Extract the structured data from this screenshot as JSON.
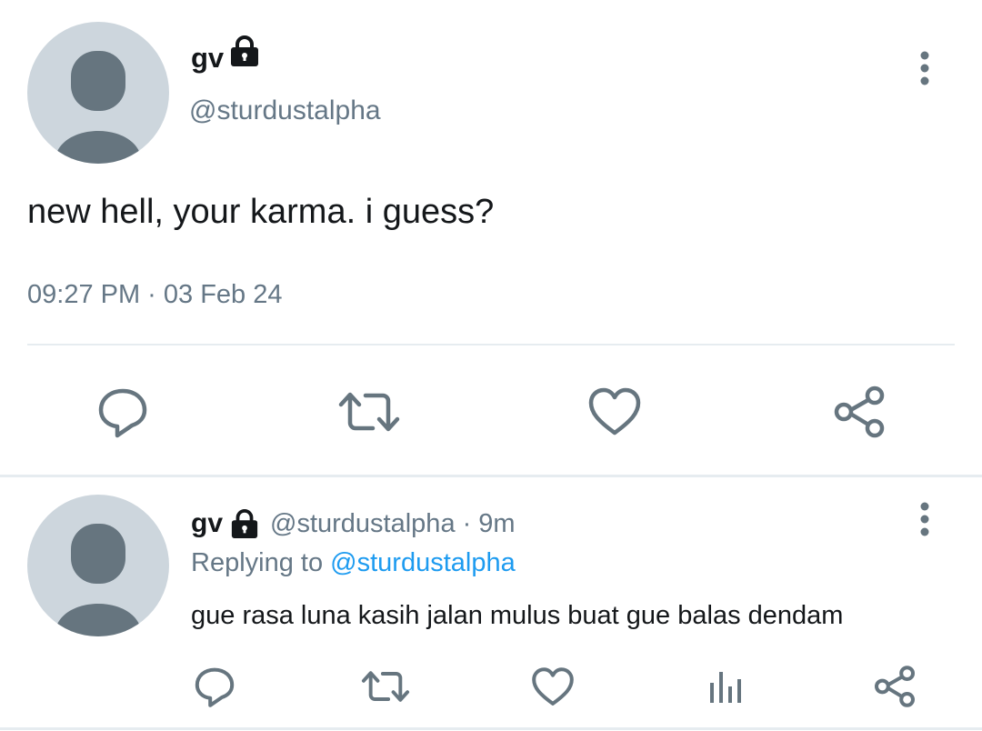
{
  "main_tweet": {
    "display_name": "gv",
    "handle": "@sturdustalpha",
    "text": "new hell, your karma. i guess?",
    "timestamp": "09:27 PM · 03 Feb 24",
    "icons": {
      "lock": "lock-icon",
      "more": "more-vertical-icon",
      "reply": "reply-icon",
      "retweet": "retweet-icon",
      "like": "like-icon",
      "share": "share-icon"
    }
  },
  "reply_tweet": {
    "display_name": "gv",
    "handle": "@sturdustalpha",
    "separator": "·",
    "age": "9m",
    "replying_prefix": "Replying to",
    "replying_to": "@sturdustalpha",
    "text": "gue rasa luna kasih jalan mulus buat gue balas dendam",
    "icons": {
      "lock": "lock-icon",
      "more": "more-vertical-icon",
      "reply": "reply-icon",
      "retweet": "retweet-icon",
      "like": "like-icon",
      "analytics": "analytics-icon",
      "share": "share-icon"
    }
  },
  "colors": {
    "text": "#14171a",
    "muted": "#657786",
    "link": "#1d9bf0",
    "avatar_bg": "#cdd6dd",
    "avatar_fg": "#66757f",
    "divider": "#e6ecf0"
  }
}
